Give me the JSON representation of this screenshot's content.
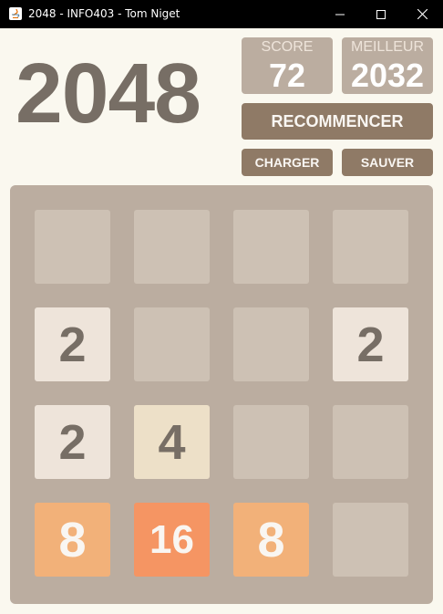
{
  "window": {
    "title": "2048 - INFO403 - Tom Niget",
    "icons": [
      "java-app-icon",
      "minimize-icon",
      "maximize-icon",
      "close-icon"
    ]
  },
  "header": {
    "title": "2048",
    "score_label": "SCORE",
    "score_value": "72",
    "best_label": "MEILLEUR",
    "best_value": "2032"
  },
  "buttons": {
    "restart": "RECOMMENCER",
    "load": "CHARGER",
    "save": "SAUVER"
  },
  "board": {
    "rows": [
      [
        "",
        "",
        "",
        ""
      ],
      [
        "2",
        "",
        "",
        "2"
      ],
      [
        "2",
        "4",
        "",
        ""
      ],
      [
        "8",
        "16",
        "8",
        ""
      ]
    ]
  },
  "colors": {
    "background": "#faf8ef",
    "board": "#bbada0",
    "empty_cell": "#cdc1b4",
    "tile_2": "#eee4da",
    "tile_4": "#ede0c8",
    "tile_8": "#f2b179",
    "tile_16": "#f59563",
    "button": "#8f7a66",
    "dark_text": "#776e65"
  }
}
